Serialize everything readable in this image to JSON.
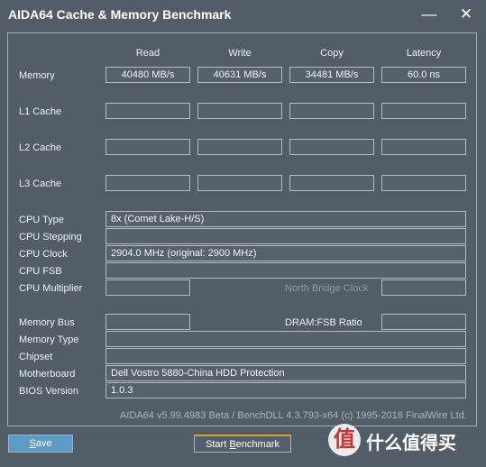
{
  "window": {
    "title": "AIDA64 Cache & Memory Benchmark"
  },
  "columns": [
    "Read",
    "Write",
    "Copy",
    "Latency"
  ],
  "rows": {
    "memory": {
      "label": "Memory",
      "values": [
        "40480 MB/s",
        "40631 MB/s",
        "34481 MB/s",
        "60.0 ns"
      ]
    },
    "l1": {
      "label": "L1 Cache",
      "values": [
        "",
        "",
        "",
        ""
      ]
    },
    "l2": {
      "label": "L2 Cache",
      "values": [
        "",
        "",
        "",
        ""
      ]
    },
    "l3": {
      "label": "L3 Cache",
      "values": [
        "",
        "",
        "",
        ""
      ]
    }
  },
  "cpu": {
    "type_label": "CPU Type",
    "type_value": "8x   (Comet Lake-H/S)",
    "stepping_label": "CPU Stepping",
    "stepping_value": "",
    "clock_label": "CPU Clock",
    "clock_value": "2904.0 MHz  (original: 2900 MHz)",
    "fsb_label": "CPU FSB",
    "fsb_value": "",
    "multiplier_label": "CPU Multiplier",
    "multiplier_value": "",
    "north_bridge_label": "North Bridge Clock",
    "north_bridge_value": ""
  },
  "system": {
    "memory_bus_label": "Memory Bus",
    "memory_bus_value": "",
    "dram_fsb_label": "DRAM:FSB Ratio",
    "dram_fsb_value": "",
    "memory_type_label": "Memory Type",
    "memory_type_value": "",
    "chipset_label": "Chipset",
    "chipset_value": "",
    "motherboard_label": "Motherboard",
    "motherboard_value": "Dell Vostro 5880-China HDD Protection",
    "bios_label": "BIOS Version",
    "bios_value": "1.0.3"
  },
  "footer": "AIDA64 v5.99.4983 Beta / BenchDLL 4.3.793-x64  (c) 1995-2018 FinalWire Ltd.",
  "buttons": {
    "save_pre": "",
    "save_key": "S",
    "save_post": "ave",
    "start_pre": "Start ",
    "start_key": "B",
    "start_post": "enchmark"
  },
  "watermark": {
    "glyph": "值",
    "text": "什么值得买"
  },
  "icons": {
    "minimize": "minimize-icon",
    "close": "close-icon"
  }
}
